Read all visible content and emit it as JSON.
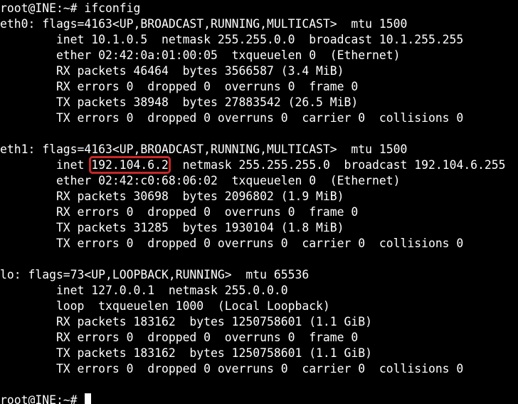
{
  "terminal": {
    "prompt": "root@INE:~# ",
    "command": "ifconfig",
    "highlight_color": "#c62828",
    "eth0": {
      "l1": "eth0: flags=4163<UP,BROADCAST,RUNNING,MULTICAST>  mtu 1500",
      "l2": "        inet 10.1.0.5  netmask 255.255.0.0  broadcast 10.1.255.255",
      "l3": "        ether 02:42:0a:01:00:05  txqueuelen 0  (Ethernet)",
      "l4": "        RX packets 46464  bytes 3566587 (3.4 MiB)",
      "l5": "        RX errors 0  dropped 0  overruns 0  frame 0",
      "l6": "        TX packets 38948  bytes 27883542 (26.5 MiB)",
      "l7": "        TX errors 0  dropped 0 overruns 0  carrier 0  collisions 0"
    },
    "eth1": {
      "l1": "eth1: flags=4163<UP,BROADCAST,RUNNING,MULTICAST>  mtu 1500",
      "inet_prefix": "        inet ",
      "inet_addr": "192.104.6.2",
      "inet_suffix": "  netmask 255.255.255.0  broadcast 192.104.6.255",
      "l3": "        ether 02:42:c0:68:06:02  txqueuelen 0  (Ethernet)",
      "l4": "        RX packets 30698  bytes 2096802 (1.9 MiB)",
      "l5": "        RX errors 0  dropped 0  overruns 0  frame 0",
      "l6": "        TX packets 31285  bytes 1930104 (1.8 MiB)",
      "l7": "        TX errors 0  dropped 0 overruns 0  carrier 0  collisions 0"
    },
    "lo": {
      "l1": "lo: flags=73<UP,LOOPBACK,RUNNING>  mtu 65536",
      "l2": "        inet 127.0.0.1  netmask 255.0.0.0",
      "l3": "        loop  txqueuelen 1000  (Local Loopback)",
      "l4": "        RX packets 183162  bytes 1250758601 (1.1 GiB)",
      "l5": "        RX errors 0  dropped 0  overruns 0  frame 0",
      "l6": "        TX packets 183162  bytes 1250758601 (1.1 GiB)",
      "l7": "        TX errors 0  dropped 0 overruns 0  carrier 0  collisions 0"
    }
  }
}
